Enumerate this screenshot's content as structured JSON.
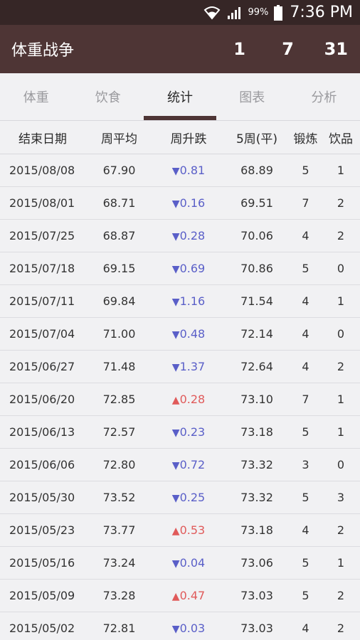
{
  "status": {
    "battery": "99%",
    "time": "7:36 PM"
  },
  "app": {
    "title": "体重战争",
    "stats": [
      "1",
      "7",
      "31"
    ]
  },
  "tabs": [
    {
      "label": "体重",
      "active": false
    },
    {
      "label": "饮食",
      "active": false
    },
    {
      "label": "统计",
      "active": true
    },
    {
      "label": "图表",
      "active": false
    },
    {
      "label": "分析",
      "active": false
    }
  ],
  "table": {
    "headers": [
      "结束日期",
      "周平均",
      "周升跌",
      "5周(平)",
      "锻炼",
      "饮品"
    ],
    "rows": [
      {
        "date": "2015/08/08",
        "avg": "67.90",
        "dir": "down",
        "chg": "0.81",
        "five": "68.89",
        "ex": "5",
        "drink": "1"
      },
      {
        "date": "2015/08/01",
        "avg": "68.71",
        "dir": "down",
        "chg": "0.16",
        "five": "69.51",
        "ex": "7",
        "drink": "2"
      },
      {
        "date": "2015/07/25",
        "avg": "68.87",
        "dir": "down",
        "chg": "0.28",
        "five": "70.06",
        "ex": "4",
        "drink": "2"
      },
      {
        "date": "2015/07/18",
        "avg": "69.15",
        "dir": "down",
        "chg": "0.69",
        "five": "70.86",
        "ex": "5",
        "drink": "0"
      },
      {
        "date": "2015/07/11",
        "avg": "69.84",
        "dir": "down",
        "chg": "1.16",
        "five": "71.54",
        "ex": "4",
        "drink": "1"
      },
      {
        "date": "2015/07/04",
        "avg": "71.00",
        "dir": "down",
        "chg": "0.48",
        "five": "72.14",
        "ex": "4",
        "drink": "0"
      },
      {
        "date": "2015/06/27",
        "avg": "71.48",
        "dir": "down",
        "chg": "1.37",
        "five": "72.64",
        "ex": "4",
        "drink": "2"
      },
      {
        "date": "2015/06/20",
        "avg": "72.85",
        "dir": "up",
        "chg": "0.28",
        "five": "73.10",
        "ex": "7",
        "drink": "1"
      },
      {
        "date": "2015/06/13",
        "avg": "72.57",
        "dir": "down",
        "chg": "0.23",
        "five": "73.18",
        "ex": "5",
        "drink": "1"
      },
      {
        "date": "2015/06/06",
        "avg": "72.80",
        "dir": "down",
        "chg": "0.72",
        "five": "73.32",
        "ex": "3",
        "drink": "0"
      },
      {
        "date": "2015/05/30",
        "avg": "73.52",
        "dir": "down",
        "chg": "0.25",
        "five": "73.32",
        "ex": "5",
        "drink": "3"
      },
      {
        "date": "2015/05/23",
        "avg": "73.77",
        "dir": "up",
        "chg": "0.53",
        "five": "73.18",
        "ex": "4",
        "drink": "2"
      },
      {
        "date": "2015/05/16",
        "avg": "73.24",
        "dir": "down",
        "chg": "0.04",
        "five": "73.06",
        "ex": "5",
        "drink": "1"
      },
      {
        "date": "2015/05/09",
        "avg": "73.28",
        "dir": "up",
        "chg": "0.47",
        "five": "73.03",
        "ex": "5",
        "drink": "2"
      },
      {
        "date": "2015/05/02",
        "avg": "72.81",
        "dir": "down",
        "chg": "0.03",
        "five": "73.03",
        "ex": "4",
        "drink": "2"
      }
    ]
  },
  "colors": {
    "status_bar": "#362626",
    "app_bar": "#4e3535",
    "down": "#5a5fc8",
    "up": "#e05a5a"
  },
  "icons": [
    "wifi-icon",
    "signal-icon",
    "battery-icon",
    "triangle-down-icon",
    "triangle-up-icon"
  ]
}
